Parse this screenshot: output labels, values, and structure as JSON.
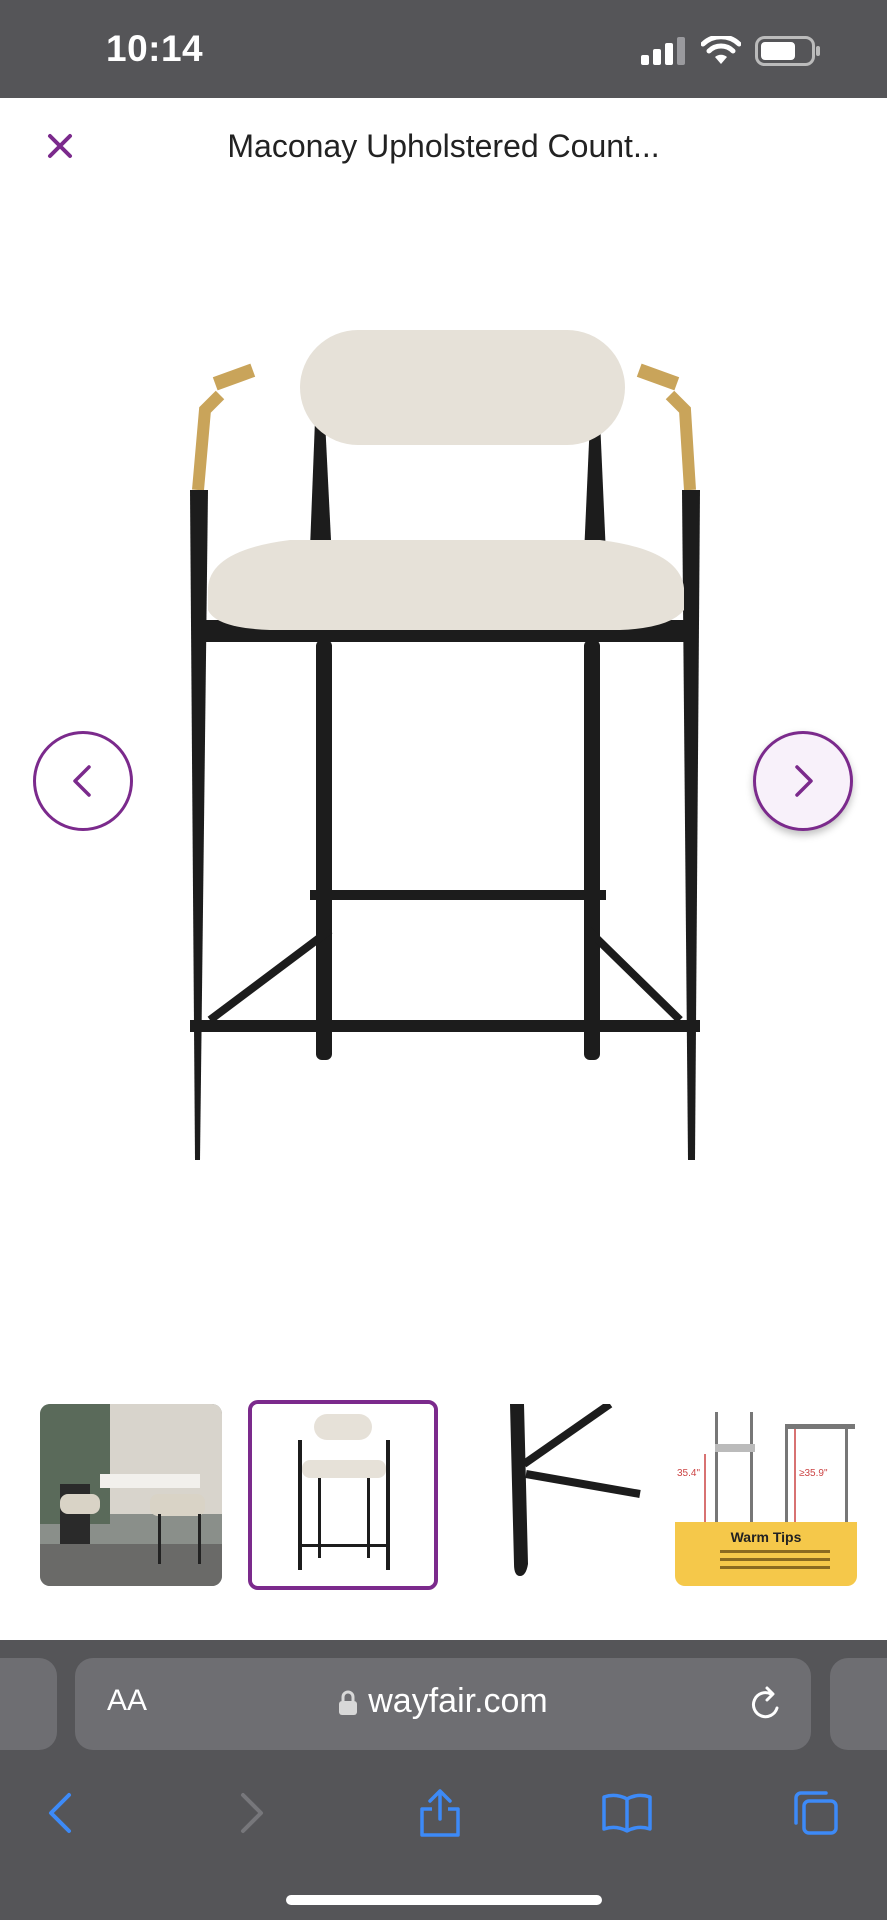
{
  "status": {
    "time": "10:14",
    "icons": [
      "cellular-signal-icon",
      "wifi-icon",
      "battery-icon"
    ]
  },
  "header": {
    "close_icon": "close-icon",
    "title": "Maconay Upholstered Count..."
  },
  "gallery": {
    "prev_icon": "chevron-left-icon",
    "next_icon": "chevron-right-icon",
    "thumbnails": [
      {
        "alt": "room scene",
        "selected": false
      },
      {
        "alt": "chair front",
        "selected": true
      },
      {
        "alt": "leg detail",
        "selected": false
      },
      {
        "alt": "dimensions",
        "selected": false,
        "badge": "Warm Tips",
        "dim_left": "35.4\"",
        "dim_right": "≥35.9\""
      }
    ]
  },
  "browser": {
    "aa_label": "AA",
    "url": "wayfair.com",
    "toolbar": [
      "back-icon",
      "forward-icon",
      "share-icon",
      "bookmarks-icon",
      "tabs-icon"
    ]
  },
  "colors": {
    "brand": "#7b2a8c",
    "chrome": "#555558",
    "ios_blue": "#3d8af7"
  }
}
